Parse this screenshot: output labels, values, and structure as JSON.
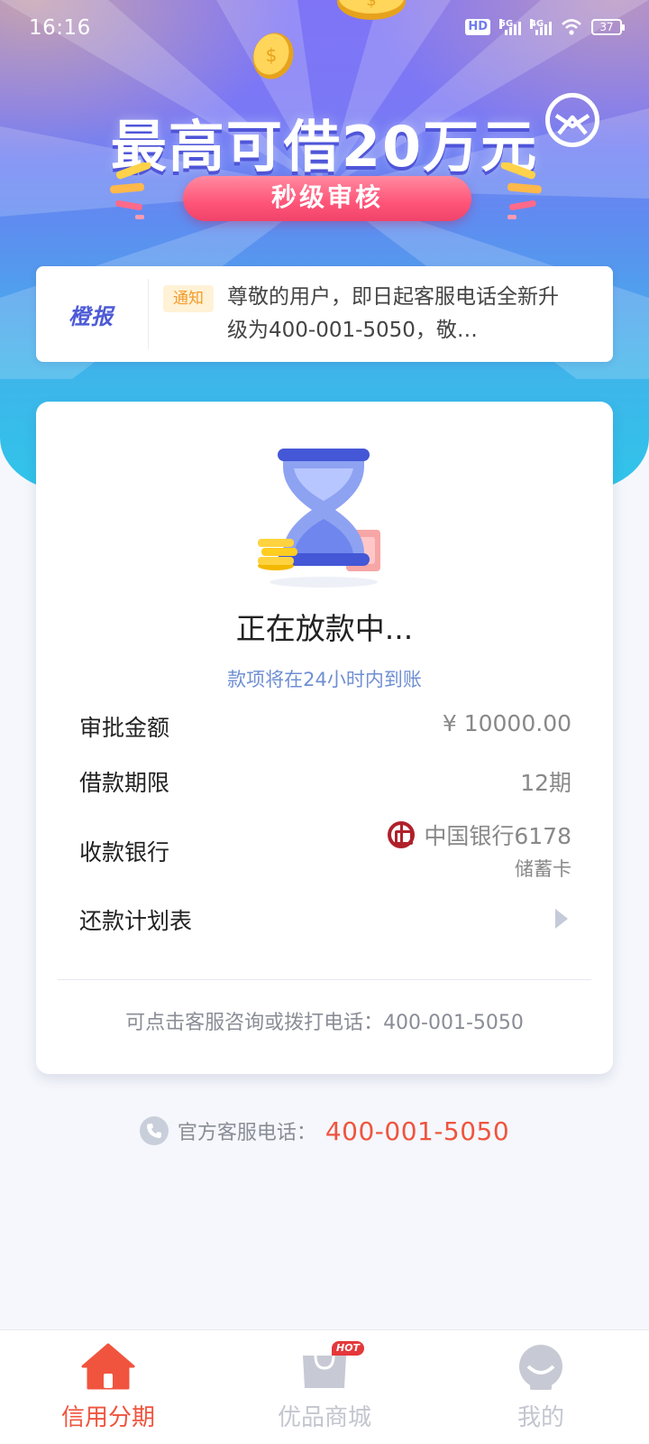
{
  "status_bar": {
    "time": "16:16",
    "hd_label": "HD",
    "net_5g": "5G",
    "net_4g": "4G",
    "battery": "37"
  },
  "banner": {
    "headline": "最高可借20万元",
    "pill": "秒级审核",
    "brand_icon": "envelope-circle-logo-icon"
  },
  "notice": {
    "brand": "橙报",
    "tag": "通知",
    "text": "尊敬的用户，即日起客服电话全新升级为400-001-5050，敬…"
  },
  "loan_status": {
    "illustration": "hourglass-icon",
    "title": "正在放款中...",
    "subtitle": "款项将在24小时内到账",
    "rows": {
      "amount_label": "审批金额",
      "amount_value": "¥ 10000.00",
      "term_label": "借款期限",
      "term_value": "12期",
      "bank_label": "收款银行",
      "bank_value": "中国银行6178",
      "bank_card_type": "储蓄卡",
      "plan_label": "还款计划表"
    },
    "footer": "可点击客服咨询或拨打电话：400-001-5050"
  },
  "hotline": {
    "label": "官方客服电话：",
    "number": "400-001-5050"
  },
  "bottom_nav": {
    "items": [
      {
        "label": "信用分期",
        "icon": "home-icon",
        "active": true
      },
      {
        "label": "优品商城",
        "icon": "shopping-bag-icon",
        "badge": "HOT",
        "active": false
      },
      {
        "label": "我的",
        "icon": "profile-icon",
        "active": false
      }
    ]
  },
  "colors": {
    "accent": "#f0543e",
    "brand_blue": "#4d5bd6",
    "pill_pink": "#ff5478",
    "bank_red": "#b0202a"
  }
}
